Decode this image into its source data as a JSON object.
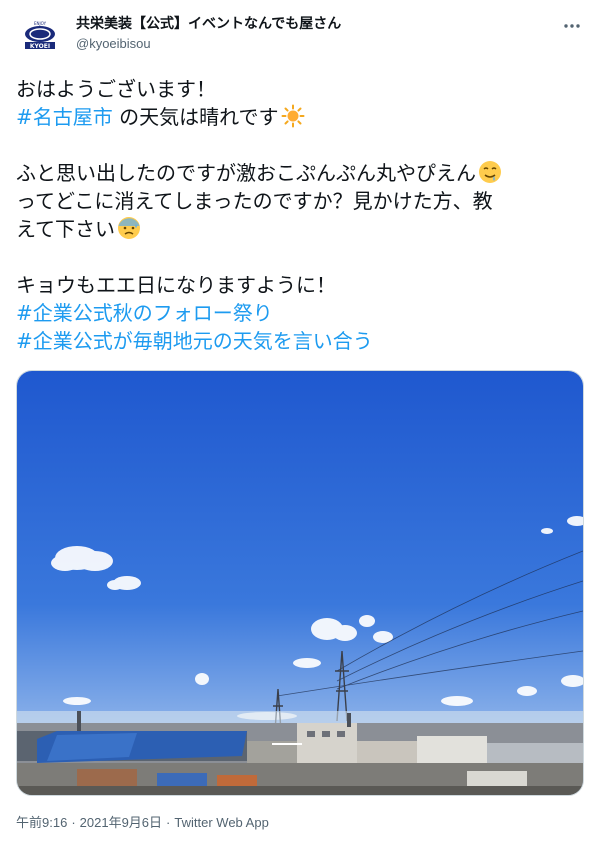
{
  "author": {
    "display_name": "共栄美装【公式】イベントなんでも屋さん",
    "handle": "@kyoeibisou",
    "avatar_logo_text": "KYOEI"
  },
  "tweet": {
    "line1": "おはようございます！",
    "hashtag_city": "#名古屋市",
    "line2_rest": " の天気は晴れです",
    "line3": "ふと思い出したのですが激おこぷんぷん丸やぴえん",
    "line4": "ってどこに消えてしまったのですか？見かけた方、教",
    "line5": "えて下さい",
    "line6": "キョウもエエ日になりますように！",
    "hashtag1": "#企業公式秋のフォロー祭り",
    "hashtag2": "#企業公式が毎朝地元の天気を言い合う"
  },
  "emojis": [
    "sun-emoji",
    "drooling-face-emoji",
    "anxious-sweat-face-emoji"
  ],
  "meta": {
    "time": "午前9:16",
    "separator": "·",
    "date": "2021年9月6日",
    "source": "Twitter Web App"
  },
  "colors": {
    "link": "#1d9bf0",
    "text": "#0f1419",
    "secondary": "#536471",
    "sky_top": "#2a63d6",
    "sky_bottom": "#a9c6ee"
  }
}
